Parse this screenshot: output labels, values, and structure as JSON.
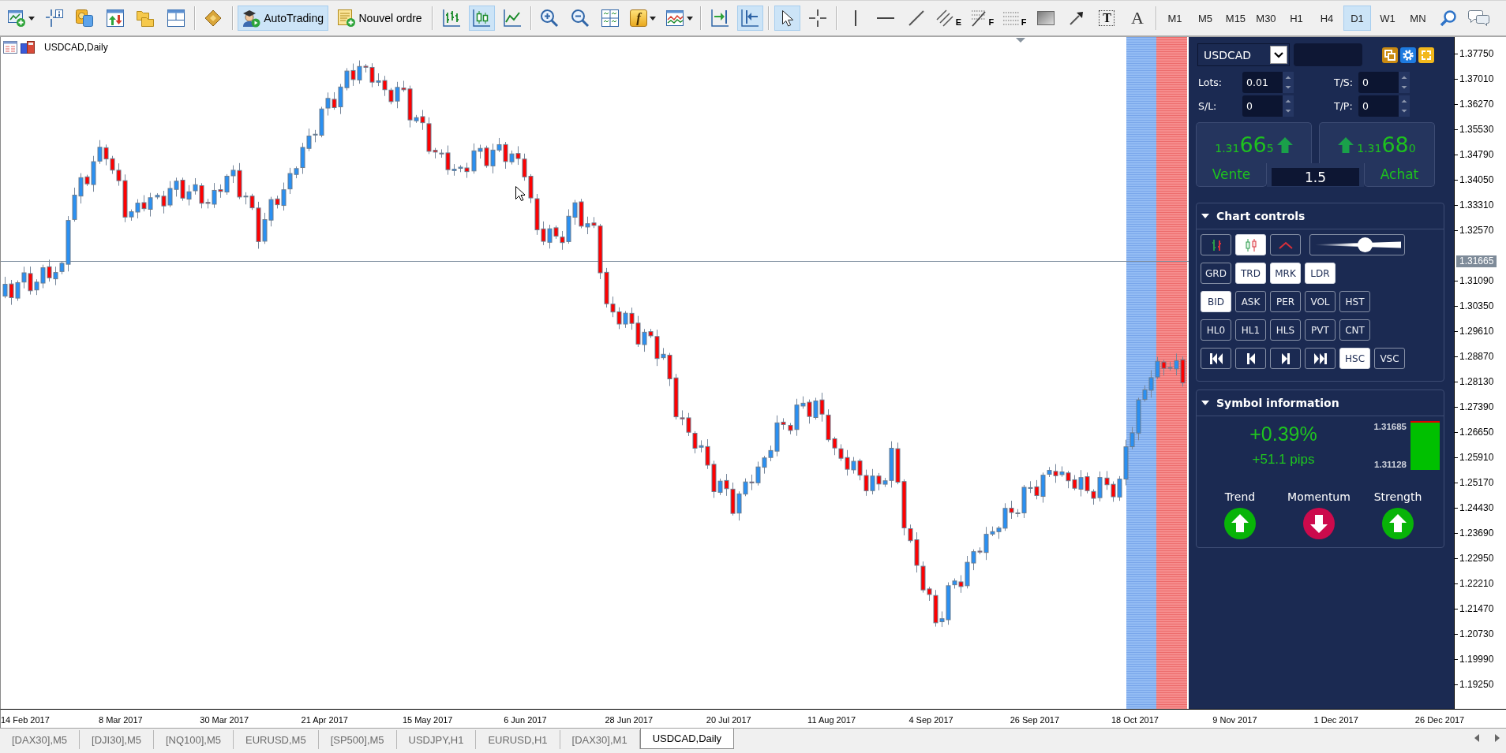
{
  "toolbar": [
    [
      {
        "kind": "icon-menu",
        "selected": false
      },
      {
        "kind": "icon",
        "selected": false
      },
      {
        "kind": "icon",
        "selected": false
      },
      {
        "kind": "icon",
        "selected": false
      },
      {
        "kind": "icon",
        "selected": false
      },
      {
        "kind": "icon",
        "selected": false
      }
    ],
    [
      {
        "kind": "icon",
        "selected": false
      }
    ],
    [
      {
        "kind": "icon-text",
        "label": "AutoTrading",
        "selected": true
      },
      {
        "kind": "icon-text",
        "label": "Nouvel ordre",
        "selected": false
      }
    ],
    [
      {
        "kind": "icon",
        "selected": false
      },
      {
        "kind": "icon",
        "selected": true
      },
      {
        "kind": "icon",
        "selected": false
      }
    ],
    [
      {
        "kind": "icon",
        "selected": false
      },
      {
        "kind": "icon",
        "selected": false
      },
      {
        "kind": "icon",
        "selected": false
      },
      {
        "kind": "letter-menu",
        "label": "f",
        "selected": false
      },
      {
        "kind": "icon-menu",
        "selected": false
      }
    ],
    [
      {
        "kind": "icon",
        "selected": false
      },
      {
        "kind": "icon",
        "selected": true
      }
    ],
    [
      {
        "kind": "icon",
        "selected": true
      },
      {
        "kind": "icon",
        "selected": false
      }
    ],
    [
      {
        "kind": "icon",
        "selected": false
      },
      {
        "kind": "icon",
        "selected": false
      },
      {
        "kind": "icon",
        "selected": false
      },
      {
        "kind": "icon-letter",
        "label": "E",
        "selected": false
      },
      {
        "kind": "icon-letter",
        "label": "F",
        "selected": false
      },
      {
        "kind": "icon-letter",
        "label": "F",
        "selected": false
      },
      {
        "kind": "icon",
        "selected": false
      },
      {
        "kind": "icon",
        "selected": false
      },
      {
        "kind": "boxed-letter",
        "label": "T",
        "selected": false
      },
      {
        "kind": "letter",
        "label": "A",
        "selected": false
      }
    ],
    [
      {
        "kind": "timeframe",
        "label": "M1",
        "selected": false
      },
      {
        "kind": "timeframe",
        "label": "M5",
        "selected": false
      },
      {
        "kind": "timeframe",
        "label": "M15",
        "selected": false
      },
      {
        "kind": "timeframe",
        "label": "M30",
        "selected": false
      },
      {
        "kind": "timeframe",
        "label": "H1",
        "selected": false
      },
      {
        "kind": "timeframe",
        "label": "H4",
        "selected": false
      },
      {
        "kind": "timeframe",
        "label": "D1",
        "selected": true
      },
      {
        "kind": "timeframe",
        "label": "W1",
        "selected": false
      },
      {
        "kind": "timeframe",
        "label": "MN",
        "selected": false
      },
      {
        "kind": "icon",
        "selected": false
      },
      {
        "kind": "icon",
        "selected": false
      }
    ]
  ],
  "chart": {
    "title": "USDCAD,Daily",
    "price_axis": {
      "labels_above": [
        "1.37750",
        "1.37010",
        "1.36270",
        "1.35530",
        "1.34790",
        "1.34050",
        "1.33310",
        "1.32570"
      ],
      "current_price": "1.31665",
      "labels_below": [
        "1.31090",
        "1.30350",
        "1.29610",
        "1.28870",
        "1.28130",
        "1.27390",
        "1.26650",
        "1.25910",
        "1.25170",
        "1.24430",
        "1.23690",
        "1.22950",
        "1.22210",
        "1.21470",
        "1.20730",
        "1.19990",
        "1.19250"
      ]
    },
    "time_axis": [
      "14 Feb 2017",
      "8 Mar 2017",
      "30 Mar 2017",
      "21 Apr 2017",
      "15 May 2017",
      "6 Jun 2017",
      "28 Jun 2017",
      "20 Jul 2017",
      "11 Aug 2017",
      "4 Sep 2017",
      "26 Sep 2017",
      "18 Oct 2017",
      "9 Nov 2017",
      "1 Dec 2017",
      "26 Dec 2017"
    ]
  },
  "panel": {
    "symbol": "USDCAD",
    "fields": [
      {
        "label": "Lots:",
        "value": "0.01"
      },
      {
        "label": "T/S:",
        "value": "0"
      },
      {
        "label": "S/L:",
        "value": "0"
      },
      {
        "label": "T/P:",
        "value": "0"
      }
    ],
    "sell": {
      "price_head": "1.31",
      "price_pips": "66",
      "price_tail": "5",
      "rising": true,
      "label": "Vente"
    },
    "spread": "1.5",
    "buy": {
      "price_head": "1.31",
      "price_pips": "68",
      "price_tail": "0",
      "rising": true,
      "label": "Achat"
    },
    "chart_controls": {
      "title": "Chart controls",
      "expanded": true,
      "rows": [
        [
          {
            "kind": "icon",
            "selected": false
          },
          {
            "kind": "icon",
            "selected": true
          },
          {
            "kind": "icon",
            "selected": false
          },
          {
            "kind": "slider",
            "level": 0.58
          }
        ],
        [
          {
            "kind": "text",
            "label": "GRD",
            "selected": false
          },
          {
            "kind": "text",
            "label": "TRD",
            "selected": true
          },
          {
            "kind": "text",
            "label": "MRK",
            "selected": true
          },
          {
            "kind": "text",
            "label": "LDR",
            "selected": true
          }
        ],
        [
          {
            "kind": "text",
            "label": "BID",
            "selected": true
          },
          {
            "kind": "text",
            "label": "ASK",
            "selected": false
          },
          {
            "kind": "text",
            "label": "PER",
            "selected": false
          },
          {
            "kind": "text",
            "label": "VOL",
            "selected": false
          },
          {
            "kind": "text",
            "label": "HST",
            "selected": false
          }
        ],
        [
          {
            "kind": "text",
            "label": "HL0",
            "selected": false
          },
          {
            "kind": "text",
            "label": "HL1",
            "selected": false
          },
          {
            "kind": "text",
            "label": "HLS",
            "selected": false
          },
          {
            "kind": "text",
            "label": "PVT",
            "selected": false
          },
          {
            "kind": "text",
            "label": "CNT",
            "selected": false
          }
        ],
        [
          {
            "kind": "icon",
            "selected": false
          },
          {
            "kind": "icon",
            "selected": false
          },
          {
            "kind": "icon",
            "selected": false
          },
          {
            "kind": "icon",
            "selected": false
          },
          {
            "kind": "text",
            "label": "HSC",
            "selected": true
          },
          {
            "kind": "text",
            "label": "VSC",
            "selected": false
          }
        ]
      ]
    },
    "symbol_info": {
      "title": "Symbol information",
      "expanded": true,
      "change_percent": "+0.39%",
      "change_pips": "+51.1 pips",
      "high": "1.31685",
      "low": "1.31128",
      "range": {
        "level": 0.96
      },
      "indicators": [
        {
          "label": "Trend",
          "rising": true
        },
        {
          "label": "Momentum",
          "rising": false
        },
        {
          "label": "Strength",
          "rising": true
        }
      ]
    }
  },
  "tabs": [
    {
      "label": "[DAX30],M5",
      "selected": false
    },
    {
      "label": "[DJI30],M5",
      "selected": false
    },
    {
      "label": "[NQ100],M5",
      "selected": false
    },
    {
      "label": "EURUSD,M5",
      "selected": false
    },
    {
      "label": "[SP500],M5",
      "selected": false
    },
    {
      "label": "USDJPY,H1",
      "selected": false
    },
    {
      "label": "EURUSD,H1",
      "selected": false
    },
    {
      "label": "[DAX30],M1",
      "selected": false
    },
    {
      "label": "USDCAD,Daily",
      "selected": true
    }
  ]
}
